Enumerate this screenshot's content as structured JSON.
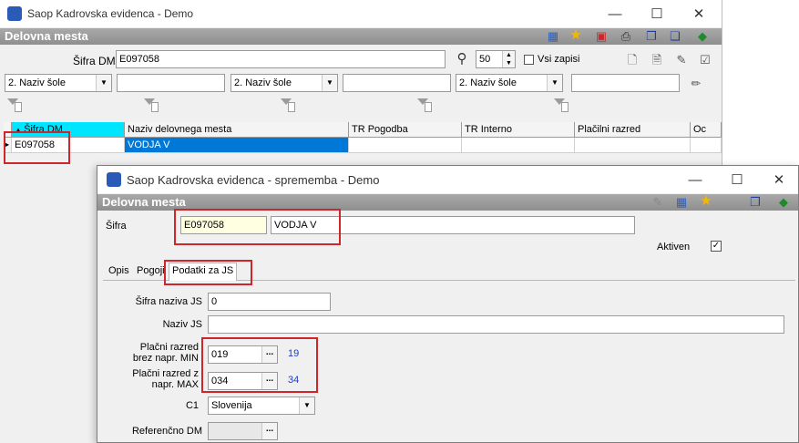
{
  "main_window": {
    "title": "Saop Kadrovska evidenca - Demo",
    "controls": {
      "minimize": "—",
      "maximize": "☐",
      "close": "✕"
    },
    "section_title": "Delovna mesta",
    "search": {
      "label": "Šifra DM",
      "value": "E097058",
      "count": "50",
      "all_records_label": "Vsi zapisi"
    },
    "filters": [
      {
        "combo": "2. Naziv šole",
        "text": ""
      },
      {
        "combo": "2. Naziv šole",
        "text": ""
      },
      {
        "combo": "2. Naziv šole",
        "text": ""
      }
    ],
    "grid": {
      "columns": [
        "Šifra DM",
        "Naziv delovnega mesta",
        "TR Pogodba",
        "TR Interno",
        "Plačilni razred",
        "Oc"
      ],
      "rows": [
        [
          "E097058",
          "VODJA V",
          "",
          "",
          "",
          ""
        ]
      ]
    },
    "icons": [
      "tree-icon",
      "star-icon",
      "delete-icon",
      "print-icon",
      "copy-icon",
      "export-icon",
      "book-icon",
      "new-doc-icon",
      "edit-doc-icon",
      "note-icon",
      "check-doc-icon",
      "pencil-icon"
    ]
  },
  "dialog": {
    "title": "Saop Kadrovska evidenca - sprememba - Demo",
    "controls": {
      "minimize": "—",
      "maximize": "☐",
      "close": "✕"
    },
    "section_title": "Delovna mesta",
    "sifra_label": "Šifra",
    "sifra_value": "E097058",
    "naziv_value": "VODJA V",
    "aktiven_label": "Aktiven",
    "aktiven_checked": "✓",
    "tabs": [
      "Opis",
      "Pogoji",
      "Podatki za JS"
    ],
    "active_tab": "Podatki za JS",
    "fields": {
      "sifra_naziva_js": {
        "label": "Šifra naziva JS",
        "value": "0"
      },
      "naziv_js": {
        "label": "Naziv JS",
        "value": ""
      },
      "placni_min": {
        "label_line1": "Plačni razred",
        "label_line2": "brez napr. MIN",
        "value": "019",
        "extra": "19"
      },
      "placni_max": {
        "label_line1": "Plačni razred z",
        "label_line2": "napr. MAX",
        "value": "034",
        "extra": "34"
      },
      "c1": {
        "label": "C1",
        "value": "Slovenija"
      },
      "referencno_dm": {
        "label": "Referenčno DM",
        "value": ""
      }
    }
  },
  "colors": {
    "highlight": "#0078d7",
    "selection_cyan": "#00e5ff",
    "accent_red": "#d0262b",
    "link_blue": "#1a3fcc",
    "yellow_field": "#ffffe1"
  }
}
